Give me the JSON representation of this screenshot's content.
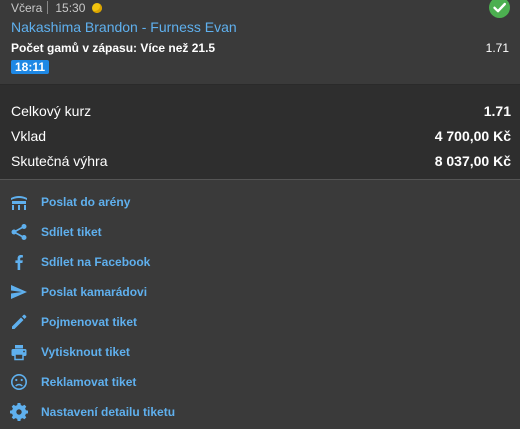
{
  "bet": {
    "day": "Včera",
    "time": "15:30",
    "sport_icon": "tennis-ball-icon",
    "status_icon": "check-circle-icon",
    "status_color": "#4caf50",
    "event": "Nakashima Brandon - Furness Evan",
    "market_label": "Počet gamů v zápasu:",
    "selection": "Více než 21.5",
    "odds": "1.71",
    "live_time": "18:11",
    "accent_color": "#5fb0ee"
  },
  "summary": {
    "rows": [
      {
        "label": "Celkový kurz",
        "value": "1.71"
      },
      {
        "label": "Vklad",
        "value": "4 700,00 Kč"
      },
      {
        "label": "Skutečná výhra",
        "value": "8 037,00 Kč"
      }
    ]
  },
  "actions": [
    {
      "label": "Poslat do arény",
      "icon": "arena-icon"
    },
    {
      "label": "Sdílet tiket",
      "icon": "share-icon"
    },
    {
      "label": "Sdílet na Facebook",
      "icon": "facebook-icon"
    },
    {
      "label": "Poslat kamarádovi",
      "icon": "send-icon"
    },
    {
      "label": "Pojmenovat tiket",
      "icon": "pencil-icon"
    },
    {
      "label": "Vytisknout tiket",
      "icon": "printer-icon"
    },
    {
      "label": "Reklamovat tiket",
      "icon": "sad-face-icon"
    },
    {
      "label": "Nastavení detailu tiketu",
      "icon": "gear-icon"
    }
  ]
}
